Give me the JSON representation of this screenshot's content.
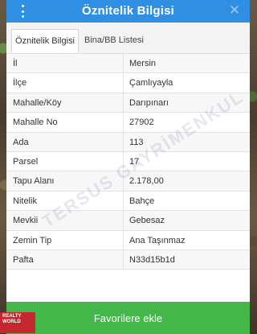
{
  "header": {
    "title": "Öznitelik Bilgisi"
  },
  "tabs": [
    {
      "label": "Öznitelik Bilgisi"
    },
    {
      "label": "Bina/BB Listesi"
    }
  ],
  "rows": [
    {
      "label": "İl",
      "value": "Mersin"
    },
    {
      "label": "İlçe",
      "value": "Çamlıyayla"
    },
    {
      "label": "Mahalle/Köy",
      "value": "Darıpınarı"
    },
    {
      "label": "Mahalle No",
      "value": "27902"
    },
    {
      "label": "Ada",
      "value": "113"
    },
    {
      "label": "Parsel",
      "value": "17"
    },
    {
      "label": "Tapu Alanı",
      "value": "2.178,00"
    },
    {
      "label": "Nitelik",
      "value": "Bahçe"
    },
    {
      "label": "Mevkii",
      "value": "Gebesaz"
    },
    {
      "label": "Zemin Tip",
      "value": "Ana Taşınmaz"
    },
    {
      "label": "Pafta",
      "value": "N33d15b1d"
    }
  ],
  "watermark": "TERSUS GAYRİMENKUL",
  "favorite_button": {
    "label": "Favorilere ekle"
  },
  "logo_text": "REALTY WORLD",
  "colors": {
    "header": "#2f8fe3",
    "button": "#45b64a"
  }
}
